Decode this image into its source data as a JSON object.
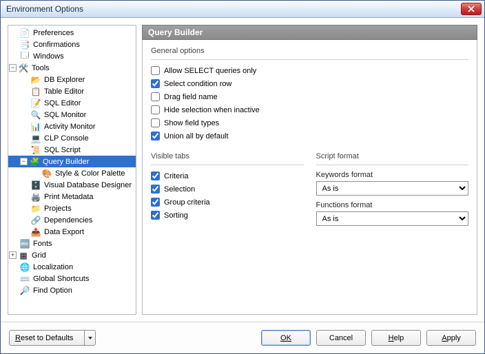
{
  "window": {
    "title": "Environment Options"
  },
  "banner": "Query Builder",
  "tree": {
    "preferences": "Preferences",
    "confirmations": "Confirmations",
    "windows": "Windows",
    "tools": "Tools",
    "db_explorer": "DB Explorer",
    "table_editor": "Table Editor",
    "sql_editor": "SQL Editor",
    "sql_monitor": "SQL Monitor",
    "activity_monitor": "Activity Monitor",
    "clp_console": "CLP Console",
    "sql_script": "SQL Script",
    "query_builder": "Query Builder",
    "style_color": "Style & Color Palette",
    "vdd": "Visual Database Designer",
    "print_metadata": "Print Metadata",
    "projects": "Projects",
    "dependencies": "Dependencies",
    "data_export": "Data Export",
    "fonts": "Fonts",
    "grid": "Grid",
    "localization": "Localization",
    "global_shortcuts": "Global Shortcuts",
    "find_option": "Find Option"
  },
  "general": {
    "title": "General options",
    "allow_select": "Allow SELECT queries only",
    "select_cond": "Select condition row",
    "drag_field": "Drag field name",
    "hide_sel": "Hide selection when inactive",
    "show_types": "Show field types",
    "union_all": "Union all by default"
  },
  "tabs": {
    "title": "Visible tabs",
    "criteria": "Criteria",
    "selection": "Selection",
    "group": "Group criteria",
    "sorting": "Sorting"
  },
  "script": {
    "title": "Script format",
    "kw_label": "Keywords format",
    "kw_value": "As is",
    "fn_label": "Functions format",
    "fn_value": "As is"
  },
  "footer": {
    "reset": "Reset to Defaults",
    "ok": "OK",
    "cancel": "Cancel",
    "help": "Help",
    "apply": "Apply"
  }
}
